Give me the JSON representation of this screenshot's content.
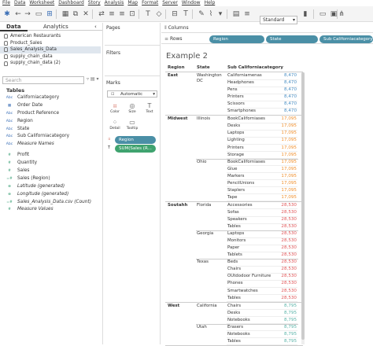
{
  "menu": [
    "File",
    "Data",
    "Worksheet",
    "Dashboard",
    "Story",
    "Analysis",
    "Map",
    "Format",
    "Server",
    "Window",
    "Help"
  ],
  "toolbar": {
    "fit": "Standard"
  },
  "tabs": {
    "data": "Data",
    "analytics": "Analytics"
  },
  "datasources": [
    "American Restaurants",
    "Product_Sales",
    "Sales_Analysis_Data",
    "supply_chain_data",
    "supply_chain_data (2)"
  ],
  "search_placeholder": "Search",
  "tables_header": "Tables",
  "fields": [
    {
      "type": "Abc",
      "kind": "dim",
      "label": "Californiacategory"
    },
    {
      "type": "▦",
      "kind": "dim",
      "label": "Order Date"
    },
    {
      "type": "Abc",
      "kind": "dim",
      "label": "Product Reference"
    },
    {
      "type": "Abc",
      "kind": "dim",
      "label": "Region"
    },
    {
      "type": "Abc",
      "kind": "dim",
      "label": "State"
    },
    {
      "type": "Abc",
      "kind": "dim",
      "label": "Sub Californiacategory"
    },
    {
      "type": "Abc",
      "kind": "dim",
      "label": "Measure Names",
      "italic": true
    },
    {
      "type": "#",
      "kind": "mea",
      "label": "Profit",
      "gap": true
    },
    {
      "type": "#",
      "kind": "mea",
      "label": "Quantity"
    },
    {
      "type": "#",
      "kind": "mea",
      "label": "Sales"
    },
    {
      "type": "=#",
      "kind": "mea",
      "label": "Sales (Region)"
    },
    {
      "type": "⊕",
      "kind": "mea",
      "label": "Latitude (generated)",
      "italic": true
    },
    {
      "type": "⊕",
      "kind": "mea",
      "label": "Longitude (generated)",
      "italic": true
    },
    {
      "type": "=#",
      "kind": "mea",
      "label": "Sales_Analysis_Data.csv (Count)",
      "italic": true
    },
    {
      "type": "#",
      "kind": "mea",
      "label": "Measure Values",
      "italic": true
    }
  ],
  "panels": {
    "pages": "Pages",
    "filters": "Filters",
    "marks": "Marks",
    "mark_type": "Automatic"
  },
  "mark_buttons": {
    "color": "Color",
    "size": "Size",
    "text": "Text",
    "detail": "Detail",
    "tooltip": "Tooltip"
  },
  "mark_pills": {
    "region": "Region",
    "sum": "SUM(Sales (R..."
  },
  "shelves": {
    "columns": "Columns",
    "rows": "Rows",
    "row_pills": [
      "Region",
      "State",
      "Sub Californiacategory"
    ]
  },
  "view": {
    "title": "Example 2",
    "headers": {
      "region": "Region",
      "state": "State",
      "sub": "Sub Californiacategory"
    },
    "colors": {
      "East": "#4a8fc4",
      "Midwest": "#f0902e",
      "Soutahh": "#e15759",
      "West": "#59b3a8"
    },
    "regions": [
      {
        "name": "East",
        "states": [
          {
            "name": "Washington DC",
            "items": [
              [
                "Californiamenas",
                "8,470"
              ],
              [
                "Headphones",
                "8,470"
              ],
              [
                "Pens",
                "8,470"
              ],
              [
                "Printers",
                "8,470"
              ],
              [
                "Scissors",
                "8,470"
              ],
              [
                "Smartphones",
                "8,470"
              ]
            ]
          }
        ]
      },
      {
        "name": "Midwest",
        "states": [
          {
            "name": "Illinois",
            "items": [
              [
                "BookCaliforniases",
                "17,095"
              ],
              [
                "Desks",
                "17,095"
              ],
              [
                "Laptops",
                "17,095"
              ],
              [
                "Lighting",
                "17,095"
              ],
              [
                "Printers",
                "17,095"
              ],
              [
                "Storage",
                "17,095"
              ]
            ]
          },
          {
            "name": "Ohio",
            "items": [
              [
                "BookCaliforniases",
                "17,095"
              ],
              [
                "Glue",
                "17,095"
              ],
              [
                "Markers",
                "17,095"
              ],
              [
                "PencilUnions",
                "17,095"
              ],
              [
                "Staplers",
                "17,095"
              ],
              [
                "Tape",
                "17,095"
              ]
            ]
          }
        ]
      },
      {
        "name": "Soutahh",
        "states": [
          {
            "name": "Florida",
            "items": [
              [
                "Accessories",
                "28,530"
              ],
              [
                "Sofas",
                "28,530"
              ],
              [
                "Speakers",
                "28,530"
              ],
              [
                "Tables",
                "28,530"
              ]
            ]
          },
          {
            "name": "Georgia",
            "items": [
              [
                "Laptops",
                "28,530"
              ],
              [
                "Monitors",
                "28,530"
              ],
              [
                "Paper",
                "28,530"
              ],
              [
                "Tablets",
                "28,530"
              ]
            ]
          },
          {
            "name": "Texas",
            "items": [
              [
                "Beds",
                "28,530"
              ],
              [
                "Chairs",
                "28,530"
              ],
              [
                "OUtdodoor Furniture",
                "28,530"
              ],
              [
                "Phones",
                "28,530"
              ],
              [
                "Smartwatches",
                "28,530"
              ],
              [
                "Tables",
                "28,530"
              ]
            ]
          }
        ]
      },
      {
        "name": "West",
        "states": [
          {
            "name": "California",
            "items": [
              [
                "Chairs",
                "8,795"
              ],
              [
                "Desks",
                "8,795"
              ],
              [
                "Notebooks",
                "8,795"
              ]
            ]
          },
          {
            "name": "Utah",
            "items": [
              [
                "Erasers",
                "8,795"
              ],
              [
                "Notebooks",
                "8,795"
              ],
              [
                "Tables",
                "8,795"
              ]
            ]
          }
        ]
      }
    ]
  }
}
